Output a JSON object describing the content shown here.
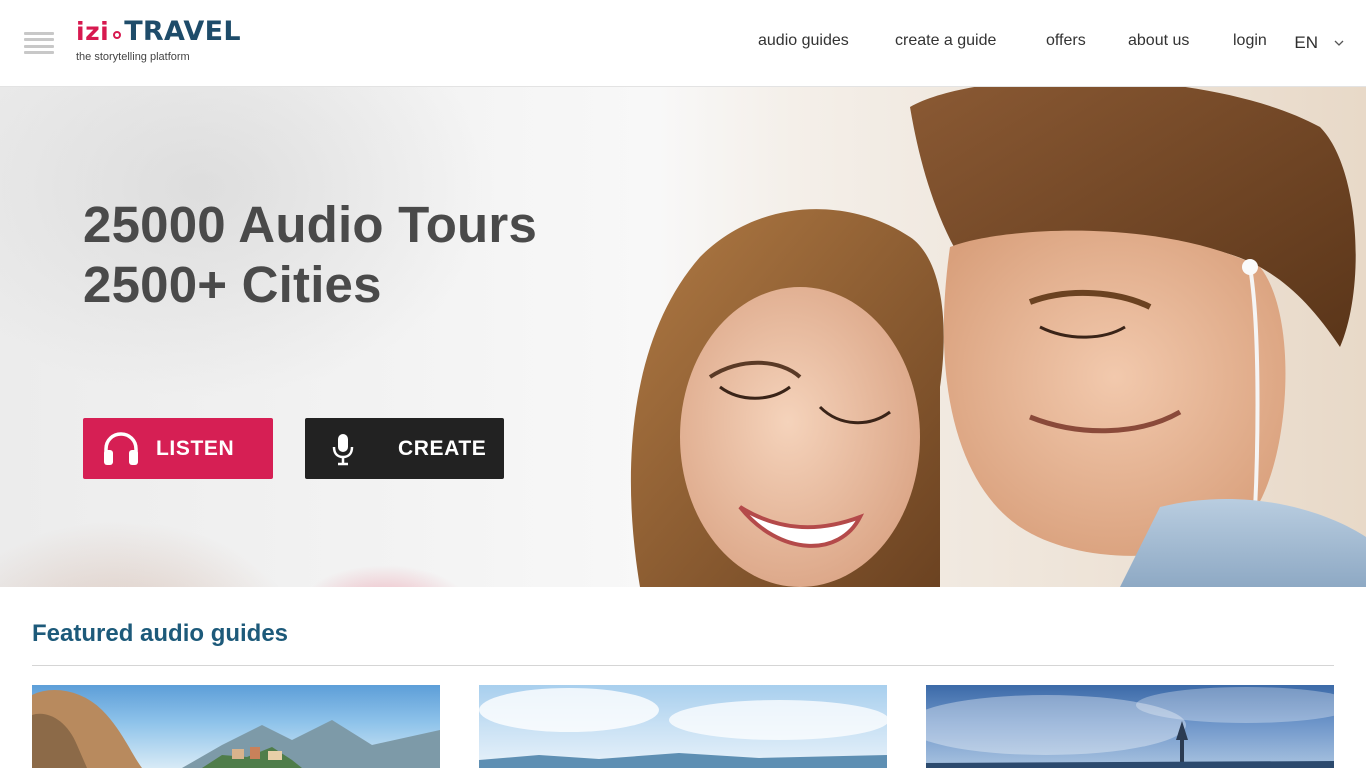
{
  "header": {
    "logo": {
      "brand_izi": "izi",
      "brand_travel": "TRAVEL",
      "tagline": "the storytelling platform"
    },
    "nav": [
      {
        "label": "audio guides"
      },
      {
        "label": "create a guide"
      },
      {
        "label": "offers"
      },
      {
        "label": "about us"
      },
      {
        "label": "login"
      }
    ],
    "language": "EN"
  },
  "hero": {
    "line1": "25000 Audio Tours",
    "line2": "2500+ Cities",
    "listen_label": "LISTEN",
    "create_label": "CREATE"
  },
  "featured": {
    "title": "Featured audio guides"
  },
  "colors": {
    "brand_red": "#d61f54",
    "brand_blue": "#1e4c6a",
    "create_button": "#222222",
    "featured_title": "#1d5a7a"
  },
  "icons": [
    "menu-icon",
    "chevron-down-icon",
    "headphones-icon",
    "microphone-icon"
  ]
}
